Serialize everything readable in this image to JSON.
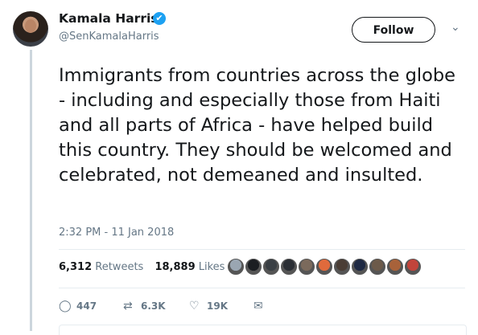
{
  "author": {
    "name": "Kamala Harris",
    "handle": "@SenKamalaHarris",
    "verified_icon": "✔"
  },
  "follow_label": "Follow",
  "caret_icon": "⌄",
  "tweet": {
    "text": "Immigrants from countries across the globe - including and especially those from Haiti and all parts of Africa - have helped build this country. They should be welcomed and celebrated, not demeaned and insulted.",
    "timestamp": "2:32 PM - 11 Jan 2018"
  },
  "stats": {
    "retweets_count": "6,312",
    "retweets_label": "Retweets",
    "likes_count": "18,889",
    "likes_label": "Likes"
  },
  "likers": [
    "#9aa6b2",
    "#1b1e22",
    "#3a3f44",
    "#2b2f35",
    "#7b6a5c",
    "#e06a3c",
    "#4a3d35",
    "#1f2a44",
    "#6c5a4a",
    "#a8623a",
    "#c1443b"
  ],
  "actions": {
    "reply_icon": "◯",
    "reply_count": "447",
    "retweet_icon": "⇄",
    "retweet_count": "6.3K",
    "like_icon": "♡",
    "like_count": "19K",
    "dm_icon": "✉"
  }
}
